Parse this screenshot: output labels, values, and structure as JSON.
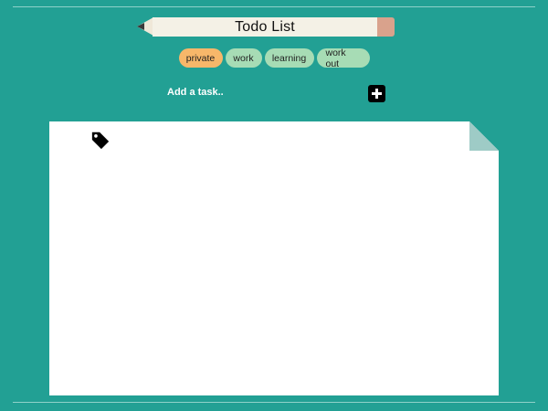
{
  "header": {
    "title": "Todo List"
  },
  "categories": [
    {
      "label": "private",
      "active": true
    },
    {
      "label": "work",
      "active": false
    },
    {
      "label": "learning",
      "active": false
    },
    {
      "label": "work out",
      "active": false
    }
  ],
  "add_task": {
    "placeholder": "Add a task..",
    "button_icon": "plus-icon"
  },
  "paper": {
    "tag_icon": "tag-icon"
  },
  "colors": {
    "background": "#22a094",
    "pill": "#a7dcb5",
    "pill_active": "#f7b76a",
    "eraser": "#d9a28c"
  }
}
